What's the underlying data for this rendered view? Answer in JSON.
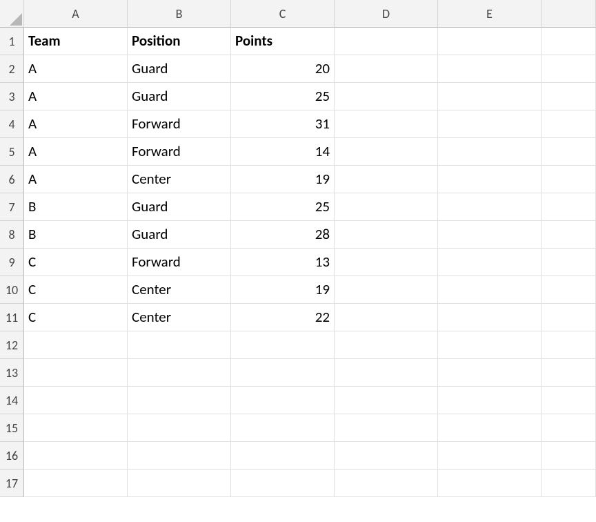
{
  "columns": [
    "A",
    "B",
    "C",
    "D",
    "E"
  ],
  "rowCount": 17,
  "headers": {
    "A": "Team",
    "B": "Position",
    "C": "Points"
  },
  "rows": [
    {
      "team": "A",
      "position": "Guard",
      "points": 20
    },
    {
      "team": "A",
      "position": "Guard",
      "points": 25
    },
    {
      "team": "A",
      "position": "Forward",
      "points": 31
    },
    {
      "team": "A",
      "position": "Forward",
      "points": 14
    },
    {
      "team": "A",
      "position": "Center",
      "points": 19
    },
    {
      "team": "B",
      "position": "Guard",
      "points": 25
    },
    {
      "team": "B",
      "position": "Guard",
      "points": 28
    },
    {
      "team": "C",
      "position": "Forward",
      "points": 13
    },
    {
      "team": "C",
      "position": "Center",
      "points": 19
    },
    {
      "team": "C",
      "position": "Center",
      "points": 22
    }
  ]
}
